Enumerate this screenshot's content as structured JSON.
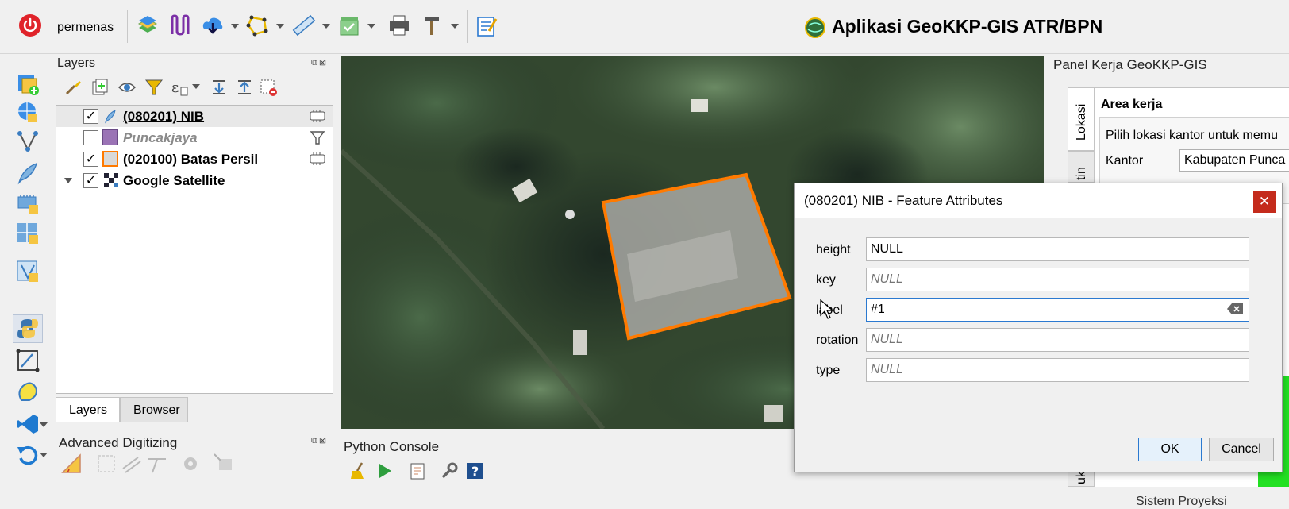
{
  "toolbar": {
    "user_label": "permenas",
    "app_title": "Aplikasi GeoKKP-GIS ATR/BPN"
  },
  "layers_panel": {
    "title": "Layers",
    "layers": [
      {
        "name": "(080201) NIB",
        "checked": true,
        "style": "bold-underline"
      },
      {
        "name": "Puncakjaya",
        "checked": false,
        "style": "italic-grey"
      },
      {
        "name": "(020100) Batas Persil",
        "checked": true,
        "style": "bold"
      },
      {
        "name": "Google Satellite",
        "checked": true,
        "style": "bold"
      }
    ],
    "tabs": [
      "Layers",
      "Browser"
    ]
  },
  "adv_digitizing": {
    "title": "Advanced Digitizing"
  },
  "python_console": {
    "title": "Python Console"
  },
  "right_panel": {
    "title": "Panel Kerja GeoKKP-GIS",
    "tab_lokasi": "Lokasi",
    "tab_partial": "tin",
    "tab_partial_bottom": "uku",
    "section_title": "Area kerja",
    "instruction": "Pilih lokasi kantor untuk memu",
    "kantor_label": "Kantor",
    "kantor_value": "Kabupaten Punca",
    "sistem_proyeksi": "Sistem Proyeksi"
  },
  "dialog": {
    "title": "(080201) NIB - Feature Attributes",
    "close_glyph": "✕",
    "fields": [
      {
        "label": "height",
        "value": "NULL",
        "placeholder": false
      },
      {
        "label": "key",
        "value": "NULL",
        "placeholder": true
      },
      {
        "label": "label",
        "value": "#1",
        "placeholder": false
      },
      {
        "label": "rotation",
        "value": "NULL",
        "placeholder": true
      },
      {
        "label": "type",
        "value": "NULL",
        "placeholder": true
      }
    ],
    "ok_label": "OK",
    "cancel_label": "Cancel"
  },
  "colors": {
    "parcel_outline": "#ff7a00",
    "power_red": "#e0232a",
    "close_red": "#c42b1c",
    "accent_blue": "#2b79d0"
  }
}
